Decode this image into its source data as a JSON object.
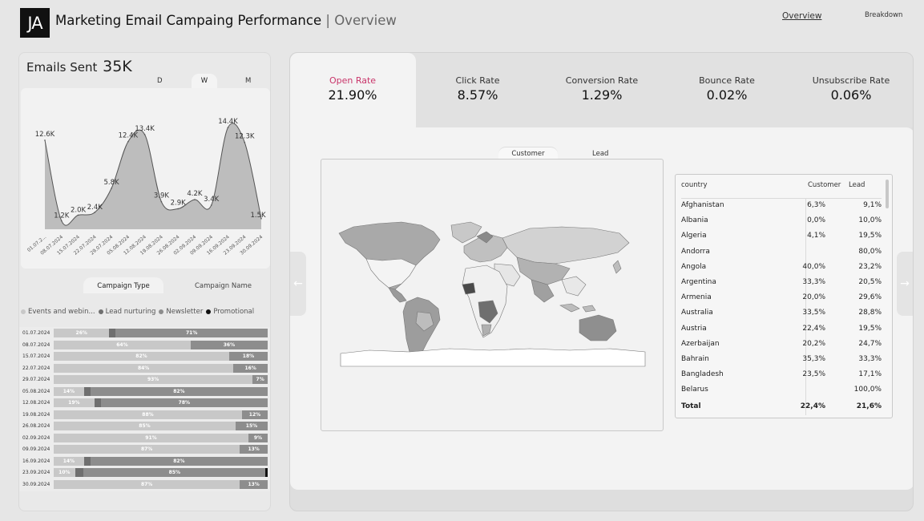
{
  "header": {
    "logo_text": "JA",
    "title_main": "Marketing Email Campaing Performance",
    "title_sep": " | ",
    "title_sub": "Overview",
    "nav_overview": "Overview",
    "nav_breakdown": "Breakdown"
  },
  "emails": {
    "label": "Emails Sent",
    "value": "35K",
    "periods": [
      "D",
      "W",
      "M"
    ],
    "selected_period": "W"
  },
  "chart_data": [
    {
      "type": "area",
      "x": [
        "01.07.2...",
        "08.07.2024",
        "15.07.2024",
        "22.07.2024",
        "29.07.2024",
        "05.08.2024",
        "12.08.2024",
        "19.08.2024",
        "26.08.2024",
        "02.09.2024",
        "09.09.2024",
        "16.09.2024",
        "23.09.2024",
        "30.09.2024"
      ],
      "values": [
        12.6,
        1.2,
        2.0,
        2.4,
        5.8,
        12.4,
        13.4,
        3.9,
        2.9,
        4.2,
        3.4,
        14.4,
        12.3,
        1.5
      ],
      "labels": [
        "12.6K",
        "1.2K",
        "2.0K",
        "2.4K",
        "5.8K",
        "12.4K",
        "13.4K",
        "3.9K",
        "2.9K",
        "4.2K",
        "3.4K",
        "14.4K",
        "12.3K",
        "1.5K"
      ],
      "ylim": [
        0,
        16
      ],
      "colors": {
        "fill": "#bdbdbd",
        "line": "#555555"
      }
    },
    {
      "type": "bar",
      "stacked": true,
      "horizontal": true,
      "legend": [
        {
          "name": "Events and webin...",
          "color": "#c8c8c8"
        },
        {
          "name": "Lead nurturing",
          "color": "#6f6f6f"
        },
        {
          "name": "Newsletter",
          "color": "#8d8d8d"
        },
        {
          "name": "Promotional",
          "color": "#111111"
        }
      ],
      "rows": [
        {
          "date": "01.07.2024",
          "segs": [
            26,
            3,
            71,
            0
          ],
          "labels": [
            "26%",
            "",
            "71%",
            ""
          ]
        },
        {
          "date": "08.07.2024",
          "segs": [
            64,
            0,
            36,
            0
          ],
          "labels": [
            "64%",
            "",
            "36%",
            ""
          ]
        },
        {
          "date": "15.07.2024",
          "segs": [
            82,
            0,
            18,
            0
          ],
          "labels": [
            "82%",
            "",
            "18%",
            ""
          ]
        },
        {
          "date": "22.07.2024",
          "segs": [
            84,
            0,
            16,
            0
          ],
          "labels": [
            "84%",
            "",
            "16%",
            ""
          ]
        },
        {
          "date": "29.07.2024",
          "segs": [
            93,
            0,
            7,
            0
          ],
          "labels": [
            "93%",
            "",
            "7%",
            ""
          ]
        },
        {
          "date": "05.08.2024",
          "segs": [
            14,
            3,
            82,
            0
          ],
          "labels": [
            "14%",
            "",
            "82%",
            ""
          ]
        },
        {
          "date": "12.08.2024",
          "segs": [
            19,
            3,
            78,
            0
          ],
          "labels": [
            "19%",
            "",
            "78%",
            ""
          ]
        },
        {
          "date": "19.08.2024",
          "segs": [
            88,
            0,
            12,
            0
          ],
          "labels": [
            "88%",
            "",
            "12%",
            ""
          ]
        },
        {
          "date": "26.08.2024",
          "segs": [
            85,
            0,
            15,
            0
          ],
          "labels": [
            "85%",
            "",
            "15%",
            ""
          ]
        },
        {
          "date": "02.09.2024",
          "segs": [
            91,
            0,
            9,
            0
          ],
          "labels": [
            "91%",
            "",
            "9%",
            ""
          ]
        },
        {
          "date": "09.09.2024",
          "segs": [
            87,
            0,
            13,
            0
          ],
          "labels": [
            "87%",
            "",
            "13%",
            ""
          ]
        },
        {
          "date": "16.09.2024",
          "segs": [
            14,
            3,
            82,
            0
          ],
          "labels": [
            "14%",
            "",
            "82%",
            ""
          ]
        },
        {
          "date": "23.09.2024",
          "segs": [
            10,
            4,
            85,
            1
          ],
          "labels": [
            "10%",
            "",
            "85%",
            ""
          ]
        },
        {
          "date": "30.09.2024",
          "segs": [
            87,
            0,
            13,
            0
          ],
          "labels": [
            "87%",
            "",
            "13%",
            ""
          ]
        }
      ]
    }
  ],
  "campaign_tabs": {
    "type": "Campaign Type",
    "name": "Campaign Name"
  },
  "kpis": [
    {
      "label": "Open Rate",
      "value": "21.90%"
    },
    {
      "label": "Click Rate",
      "value": "8.57%"
    },
    {
      "label": "Conversion Rate",
      "value": "1.29%"
    },
    {
      "label": "Bounce Rate",
      "value": "0.02%"
    },
    {
      "label": "Unsubscribe Rate",
      "value": "0.06%"
    }
  ],
  "map_tabs": {
    "customer": "Customer",
    "lead": "Lead"
  },
  "arrows": {
    "left": "←",
    "right": "→"
  },
  "table": {
    "headers": [
      "country",
      "Customer",
      "Lead"
    ],
    "rows": [
      [
        "Afghanistan",
        "6,3%",
        "9,1%"
      ],
      [
        "Albania",
        "0,0%",
        "10,0%"
      ],
      [
        "Algeria",
        "4,1%",
        "19,5%"
      ],
      [
        "Andorra",
        "",
        "80,0%"
      ],
      [
        "Angola",
        "40,0%",
        "23,2%"
      ],
      [
        "Argentina",
        "33,3%",
        "20,5%"
      ],
      [
        "Armenia",
        "20,0%",
        "29,6%"
      ],
      [
        "Australia",
        "33,5%",
        "28,8%"
      ],
      [
        "Austria",
        "22,4%",
        "19,5%"
      ],
      [
        "Azerbaijan",
        "20,2%",
        "24,7%"
      ],
      [
        "Bahrain",
        "35,3%",
        "33,3%"
      ],
      [
        "Bangladesh",
        "23,5%",
        "17,1%"
      ],
      [
        "Belarus",
        "",
        "100,0%"
      ]
    ],
    "total": [
      "Total",
      "22,4%",
      "21,6%"
    ]
  },
  "colors": {
    "accent": "#c9356a"
  }
}
